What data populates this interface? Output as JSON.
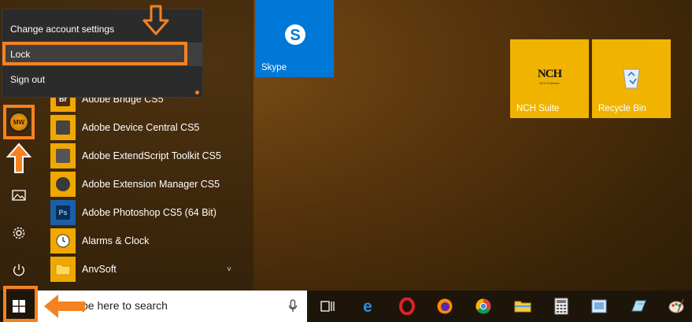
{
  "account_menu": {
    "items": [
      {
        "label": "Change account settings"
      },
      {
        "label": "Lock"
      },
      {
        "label": "Sign out"
      }
    ],
    "avatar_text": "MW"
  },
  "apps": [
    {
      "label": "Adobe Bridge CS5",
      "icon": "bridge-icon",
      "glyph": "Br"
    },
    {
      "label": "Adobe Device Central CS5",
      "icon": "device-central-icon",
      "glyph": ""
    },
    {
      "label": "Adobe ExtendScript Toolkit CS5",
      "icon": "extendscript-icon",
      "glyph": ""
    },
    {
      "label": "Adobe Extension Manager CS5",
      "icon": "extension-manager-icon",
      "glyph": ""
    },
    {
      "label": "Adobe Photoshop CS5 (64 Bit)",
      "icon": "photoshop-icon",
      "glyph": "Ps"
    },
    {
      "label": "Alarms & Clock",
      "icon": "alarm-clock-icon",
      "glyph": ""
    },
    {
      "label": "AnvSoft",
      "icon": "folder-icon",
      "glyph": ""
    }
  ],
  "tiles": [
    {
      "label": "Skype",
      "icon": "skype-icon",
      "color": "#0078d7"
    },
    {
      "label": "NCH Suite",
      "icon": "nch-icon",
      "color": "#f0b400",
      "logo_text": "NCH",
      "logo_sub": "NCH Software"
    },
    {
      "label": "Recycle Bin",
      "icon": "recycle-bin-icon",
      "color": "#f0b400"
    }
  ],
  "taskbar": {
    "search_placeholder": "Type here to search",
    "search_visible_text": "pe here to search"
  },
  "colors": {
    "accent": "#f58220",
    "tile_yellow": "#f0b400",
    "skype_blue": "#0078d7"
  }
}
